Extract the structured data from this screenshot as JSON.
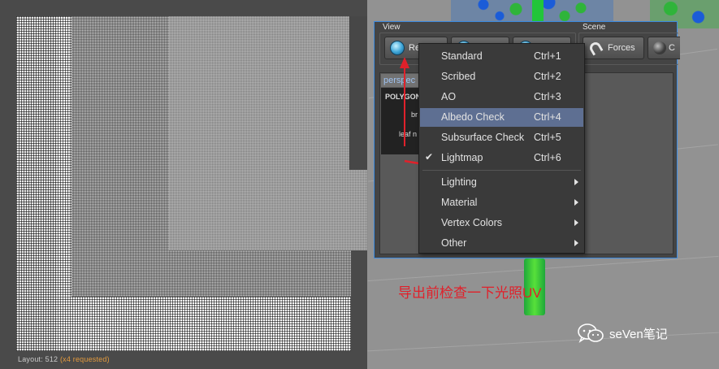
{
  "lightmap": {
    "status_prefix": "Layout: 512",
    "status_requested": "(x4 requested)"
  },
  "dialog": {
    "group_view": "View",
    "group_scene": "Scene",
    "render_button_label": "Re",
    "forces_button_label": "Forces",
    "scene_extra_label": "C",
    "viewport_tab": "perspec",
    "info": {
      "title": "POLYGON",
      "line2": "br",
      "line3": "leaf n"
    }
  },
  "menu": {
    "items": [
      {
        "label": "Standard",
        "shortcut": "Ctrl+1"
      },
      {
        "label": "Scribed",
        "shortcut": "Ctrl+2"
      },
      {
        "label": "AO",
        "shortcut": "Ctrl+3"
      },
      {
        "label": "Albedo Check",
        "shortcut": "Ctrl+4"
      },
      {
        "label": "Subsurface Check",
        "shortcut": "Ctrl+5"
      },
      {
        "label": "Lightmap",
        "shortcut": "Ctrl+6",
        "checked": true
      }
    ],
    "submenus": [
      {
        "label": "Lighting"
      },
      {
        "label": "Material"
      },
      {
        "label": "Vertex Colors"
      },
      {
        "label": "Other"
      }
    ],
    "check_glyph": "✔"
  },
  "annotation": {
    "text": "导出前检查一下光照UV",
    "color": "#e0212b"
  },
  "watermark": {
    "text": "seVen笔记"
  },
  "colors": {
    "highlight": "#5e6f92",
    "dialog_border": "#3d8be0"
  }
}
